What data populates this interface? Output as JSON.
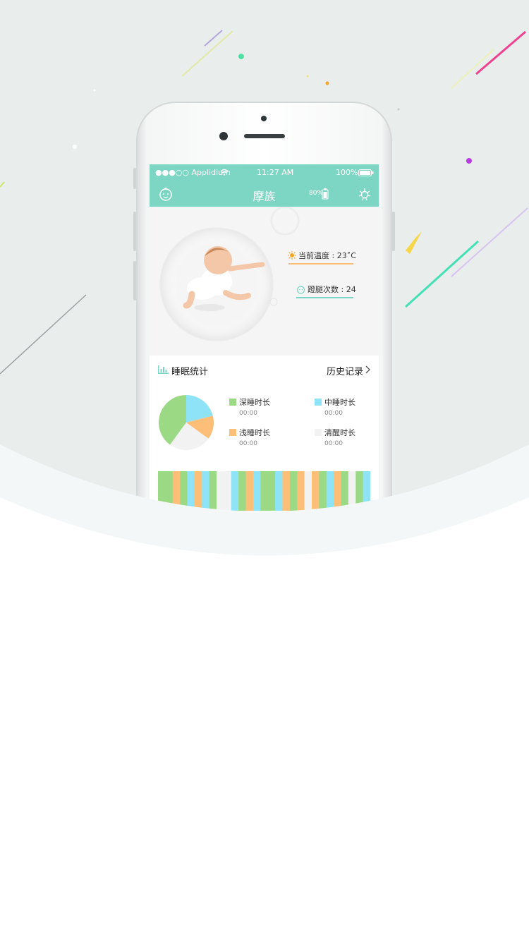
{
  "status_bar": {
    "carrier": "●●●○○ Applidium",
    "time": "11:27 AM",
    "battery": "100%"
  },
  "nav": {
    "title": "摩族",
    "device_battery": "80%"
  },
  "hero": {
    "temperature": "当前温度 : 23˚C",
    "kicks": "蹬腿次数 : 24"
  },
  "stats": {
    "title": "睡眠统计",
    "history_label": "历史记录",
    "legend": [
      {
        "label": "深睡时长",
        "value": "00:00",
        "color": "#9cd985"
      },
      {
        "label": "中睡时长",
        "value": "00:00",
        "color": "#8ee4f6"
      },
      {
        "label": "浅睡时长",
        "value": "00:00",
        "color": "#fdbf78"
      },
      {
        "label": "清醒时长",
        "value": "00:00",
        "color": "#f2f2f2"
      }
    ]
  },
  "chart_data": {
    "type": "pie",
    "categories": [
      "深睡时长",
      "中睡时长",
      "浅睡时长",
      "清醒时长"
    ],
    "values": [
      40,
      21,
      14,
      25
    ],
    "colors": [
      "#9cd985",
      "#8ee4f6",
      "#fdbf78",
      "#f2f2f2"
    ]
  },
  "sleep_timeline": [
    "deep",
    "deep",
    "light",
    "deep",
    "mid",
    "light",
    "mid",
    "deep",
    "wake",
    "wake",
    "mid",
    "deep",
    "light",
    "mid",
    "deep",
    "deep",
    "mid",
    "light",
    "deep",
    "light",
    "wake",
    "light",
    "deep",
    "mid",
    "light",
    "deep",
    "wake",
    "deep",
    "mid"
  ]
}
